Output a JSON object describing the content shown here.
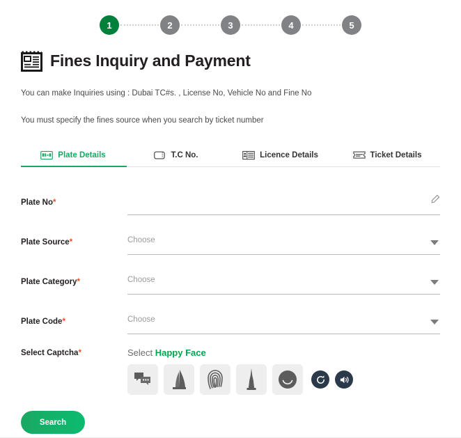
{
  "stepper": {
    "steps": [
      {
        "label": "1",
        "state": "active"
      },
      {
        "label": "2",
        "state": "inactive"
      },
      {
        "label": "3",
        "state": "inactive"
      },
      {
        "label": "4",
        "state": "inactive"
      },
      {
        "label": "5",
        "state": "inactive"
      }
    ],
    "active_color": "#00803b",
    "inactive_color": "#808285"
  },
  "header": {
    "title": "Fines Inquiry and Payment",
    "icon": "invoice-document-icon"
  },
  "info": {
    "line1": "You can make Inquiries using : Dubai TC#s. , License No, Vehicle No and Fine No",
    "line2": "You must specify the fines source when you search by ticket number"
  },
  "tabs": [
    {
      "label": "Plate Details",
      "icon": "license-plate-icon",
      "active": true
    },
    {
      "label": "T.C No.",
      "icon": "card-outline-icon",
      "active": false
    },
    {
      "label": "Licence Details",
      "icon": "id-card-icon",
      "active": false
    },
    {
      "label": "Ticket Details",
      "icon": "ticket-icon",
      "active": false
    }
  ],
  "tab_active_color": "#1fa463",
  "form": {
    "fields": [
      {
        "label": "Plate No",
        "required_mark": "*",
        "value": "",
        "placeholder": "",
        "control": "text",
        "trailing_icon": "pencil-edit-icon"
      },
      {
        "label": "Plate Source",
        "required_mark": "*",
        "value": "Choose",
        "placeholder": "Choose",
        "control": "select",
        "trailing_icon": "chevron-down-icon"
      },
      {
        "label": "Plate Category",
        "required_mark": "*",
        "value": "Choose",
        "placeholder": "Choose",
        "control": "select",
        "trailing_icon": "chevron-down-icon"
      },
      {
        "label": "Plate Code",
        "required_mark": "*",
        "value": "Choose",
        "placeholder": "Choose",
        "control": "select",
        "trailing_icon": "chevron-down-icon"
      }
    ]
  },
  "captcha": {
    "label": "Select Captcha",
    "required_mark": "*",
    "instruction_prefix": "Select ",
    "instruction_target": "Happy Face",
    "target_color": "#00a651",
    "tiles": [
      {
        "name": "chat-bubbles-icon"
      },
      {
        "name": "burj-al-arab-icon"
      },
      {
        "name": "fingerprint-icon"
      },
      {
        "name": "burj-khalifa-icon"
      },
      {
        "name": "happy-face-icon"
      }
    ],
    "refresh_button": "refresh-icon",
    "audio_button": "speaker-icon"
  },
  "actions": {
    "search_label": "Search",
    "search_color": "#12b36a"
  }
}
